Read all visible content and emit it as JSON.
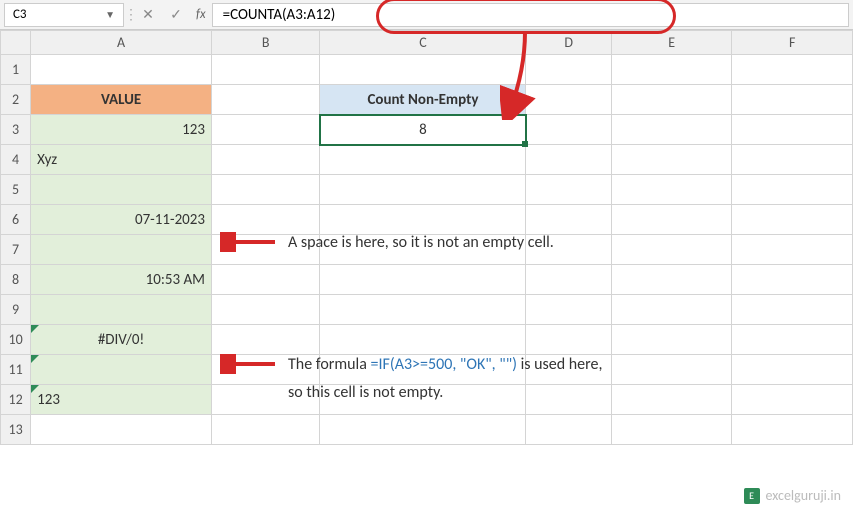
{
  "formula_bar": {
    "cell_ref": "C3",
    "fx_label": "fx",
    "formula": "=COUNTA(A3:A12)"
  },
  "col_headers": [
    "A",
    "B",
    "C",
    "D",
    "E",
    "F"
  ],
  "row_headers": [
    "1",
    "2",
    "3",
    "4",
    "5",
    "6",
    "7",
    "8",
    "9",
    "10",
    "11",
    "12",
    "13"
  ],
  "cells": {
    "A2": "VALUE",
    "A3": "123",
    "A4": "Xyz",
    "A6": "07-11-2023",
    "A8": "10:53 AM",
    "A10": "#DIV/0!",
    "A12": "123",
    "C2": "Count Non-Empty",
    "C3": "8"
  },
  "annotations": {
    "space_note": "A space is here, so it is not an empty cell.",
    "formula_note_1": "The formula ",
    "formula_note_code": "=IF(A3>=500, \"OK\", \"\")",
    "formula_note_2": " is used here,",
    "formula_note_3": "so this cell is not empty."
  },
  "watermark": "excelguruji.in"
}
